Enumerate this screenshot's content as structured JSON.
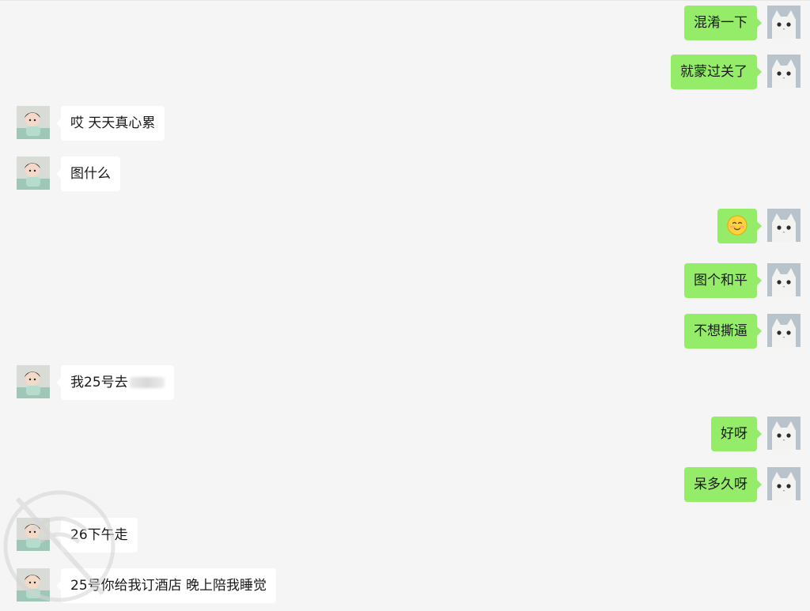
{
  "messages": [
    {
      "side": "right",
      "text": "混淆一下"
    },
    {
      "side": "right",
      "text": "就蒙过关了"
    },
    {
      "side": "left",
      "text": "哎 天天真心累"
    },
    {
      "side": "left",
      "text": "图什么"
    },
    {
      "side": "right",
      "text": "",
      "emoji": "smiling-face-emoji"
    },
    {
      "side": "right",
      "text": "图个和平"
    },
    {
      "side": "right",
      "text": "不想撕逼"
    },
    {
      "side": "left",
      "text": "我25号去",
      "redacted": true
    },
    {
      "side": "right",
      "text": "好呀"
    },
    {
      "side": "right",
      "text": "呆多久呀"
    },
    {
      "side": "left",
      "text": "26下午走"
    },
    {
      "side": "left",
      "text": "25号你给我订酒店 晚上陪我睡觉"
    }
  ],
  "avatars": {
    "self": "white-cat-avatar",
    "contact": "girl-photo-avatar"
  },
  "colors": {
    "background": "#f5f5f5",
    "self_bubble": "#95ec69",
    "contact_bubble": "#ffffff",
    "text": "#191919"
  }
}
